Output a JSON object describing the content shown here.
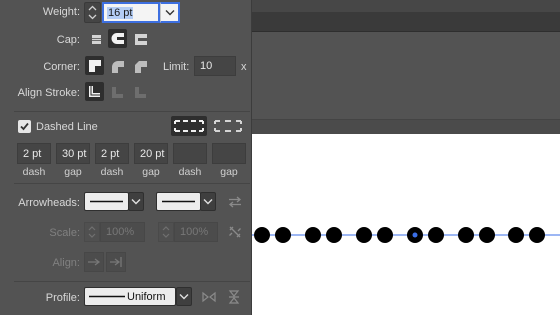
{
  "stroke_panel": {
    "weight": {
      "label": "Weight:",
      "value": "16 pt"
    },
    "cap": {
      "label": "Cap:",
      "selected": "round-cap"
    },
    "corner": {
      "label": "Corner:",
      "selected": "miter-join"
    },
    "limit": {
      "label": "Limit:",
      "value": "10",
      "suffix": "x"
    },
    "align_stroke": {
      "label": "Align Stroke:",
      "selected": "align-center"
    },
    "dashed_line": {
      "label": "Dashed Line",
      "checked": true,
      "fields": [
        {
          "value": "2 pt",
          "sub": "dash"
        },
        {
          "value": "30 pt",
          "sub": "gap"
        },
        {
          "value": "2 pt",
          "sub": "dash"
        },
        {
          "value": "20 pt",
          "sub": "gap"
        },
        {
          "value": "",
          "sub": "dash"
        },
        {
          "value": "",
          "sub": "gap"
        }
      ]
    },
    "arrowheads": {
      "label": "Arrowheads:"
    },
    "scale": {
      "label": "Scale:",
      "start": "100%",
      "end": "100%"
    },
    "align": {
      "label": "Align:"
    },
    "profile": {
      "label": "Profile:",
      "value": "Uniform"
    }
  },
  "colors": {
    "panel_bg": "#535353",
    "selection_blue": "#3d6fe0",
    "dash_dot": "#000000",
    "path_line": "#3b6fe8"
  }
}
